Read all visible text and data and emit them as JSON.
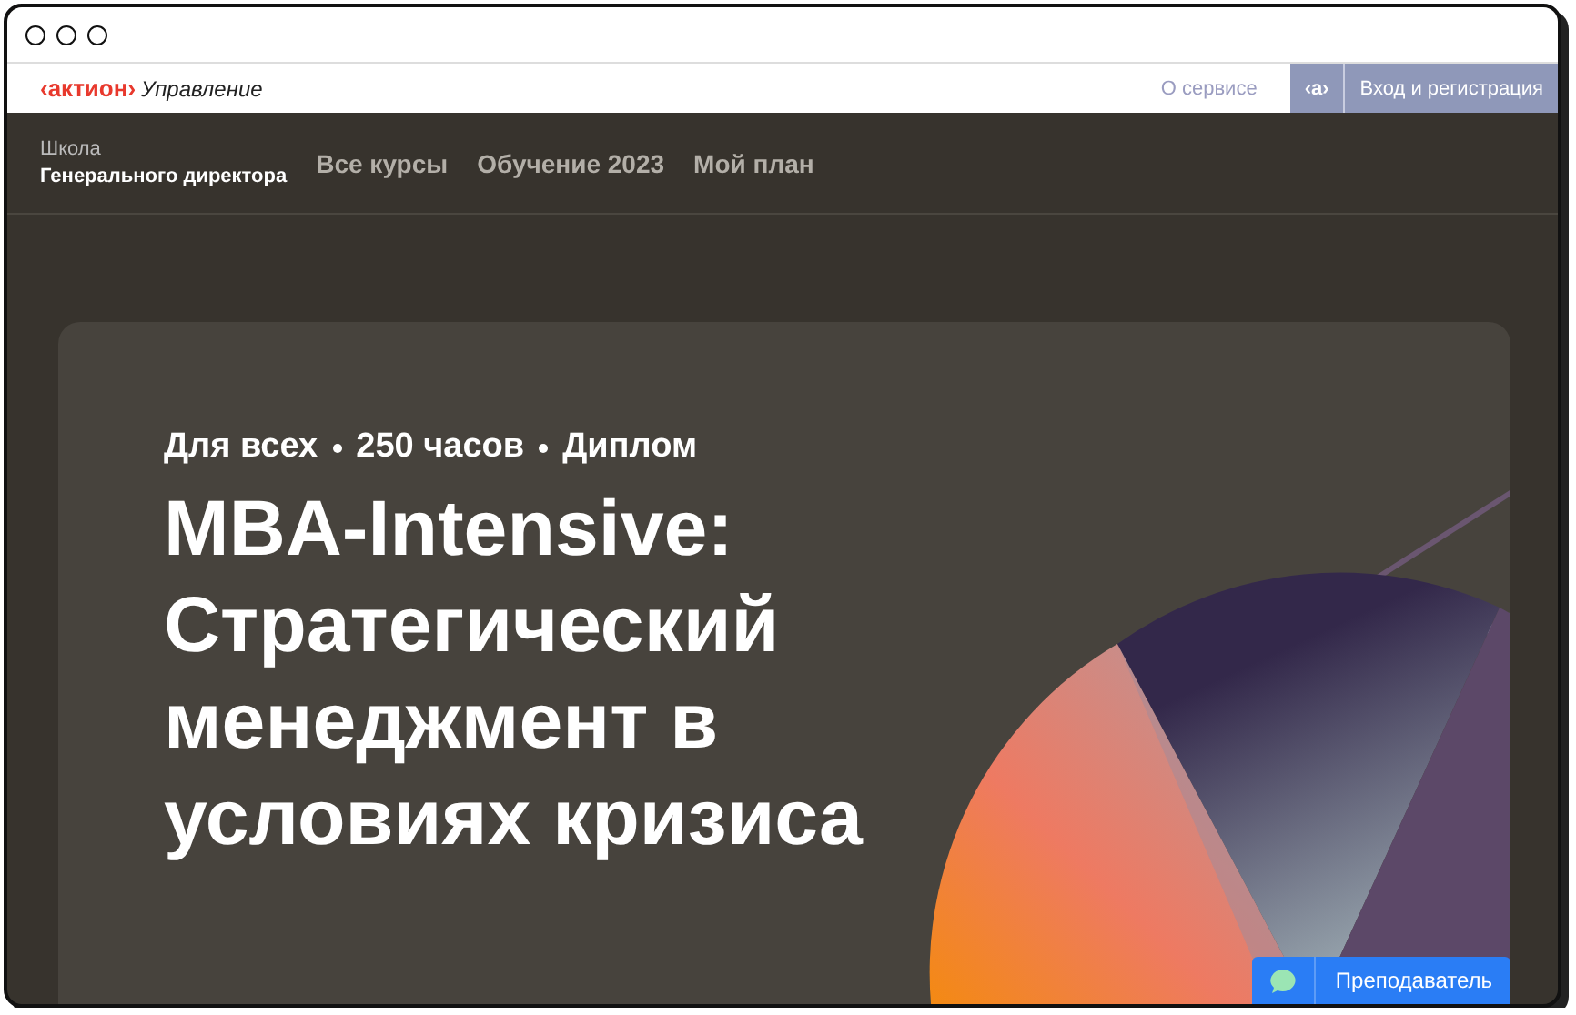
{
  "topbar": {
    "logo_brand": "‹актион›",
    "logo_product": "Управление",
    "about_link": "О сервисе",
    "brand_badge": "‹а›",
    "login_button": "Вход и регистрация"
  },
  "nav": {
    "school_caption": "Школа",
    "school_name": "Генерального директора",
    "items": [
      {
        "label": "Все курсы"
      },
      {
        "label": "Обучение 2023"
      },
      {
        "label": "Мой план"
      }
    ]
  },
  "hero": {
    "meta": [
      "Для всех",
      "250 часов",
      "Диплом"
    ],
    "title_lines": [
      "MBA-Intensive:",
      "Стратегический",
      "менеджмент в",
      "условиях кризиса"
    ]
  },
  "chat_button": {
    "label": "Преподаватель"
  }
}
